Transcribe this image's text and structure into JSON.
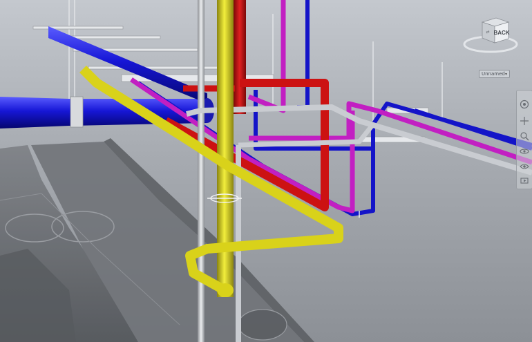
{
  "viewcube": {
    "face_label": "BACK"
  },
  "view_selector": {
    "value": "Unnamed"
  },
  "navigation_bar": {
    "tools": [
      "steering-wheel",
      "pan",
      "zoom",
      "orbit",
      "look",
      "showmotion"
    ]
  },
  "colors": {
    "background_top": "#c4c8ce",
    "background_bottom": "#8c9096",
    "pipe_blue": "#1414c8",
    "pipe_red": "#cc1212",
    "pipe_magenta": "#c21fc2",
    "pipe_yellow": "#d9d21a",
    "pipe_gray": "#c9ccd1",
    "concrete": "#6b6e72"
  }
}
